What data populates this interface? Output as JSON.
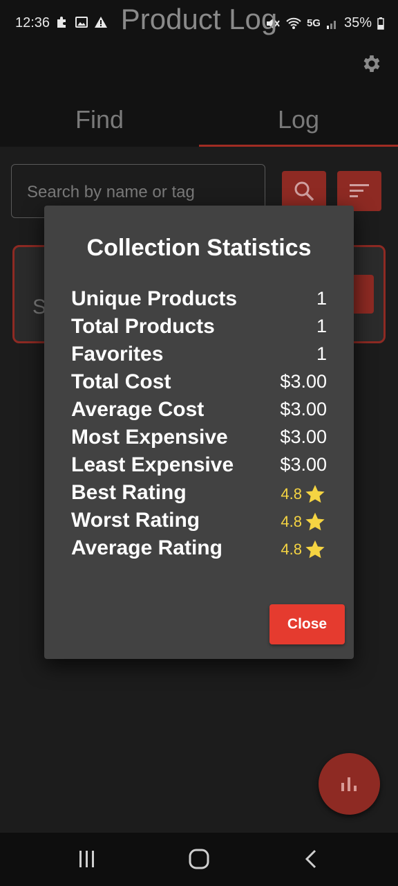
{
  "status_bar": {
    "time": "12:36",
    "network": "5G",
    "battery": "35%"
  },
  "header": {
    "title": "Product Log",
    "settings_icon": "gear-icon"
  },
  "tabs": [
    {
      "label": "Find",
      "active": false
    },
    {
      "label": "Log",
      "active": true
    }
  ],
  "search": {
    "placeholder": "Search by name or tag",
    "search_icon": "search-icon",
    "sort_icon": "sort-icon"
  },
  "background_card": {
    "letter": "S"
  },
  "dialog": {
    "title": "Collection Statistics",
    "stats": [
      {
        "label": "Unique Products",
        "value": "1"
      },
      {
        "label": "Total Products",
        "value": "1"
      },
      {
        "label": "Favorites",
        "value": "1"
      },
      {
        "label": "Total Cost",
        "value": "$3.00"
      },
      {
        "label": "Average Cost",
        "value": "$3.00"
      },
      {
        "label": "Most Expensive",
        "value": "$3.00"
      },
      {
        "label": "Least Expensive",
        "value": "$3.00"
      },
      {
        "label": "Best Rating",
        "value": "4.8"
      },
      {
        "label": "Worst Rating",
        "value": "4.8"
      },
      {
        "label": "Average Rating",
        "value": "4.8"
      }
    ],
    "close_label": "Close"
  },
  "fab": {
    "icon": "bar-chart-icon"
  },
  "colors": {
    "accent": "#e53b2f",
    "accent_dim": "#8e2a23",
    "star": "#f5d442",
    "dialog_bg": "#424242"
  }
}
